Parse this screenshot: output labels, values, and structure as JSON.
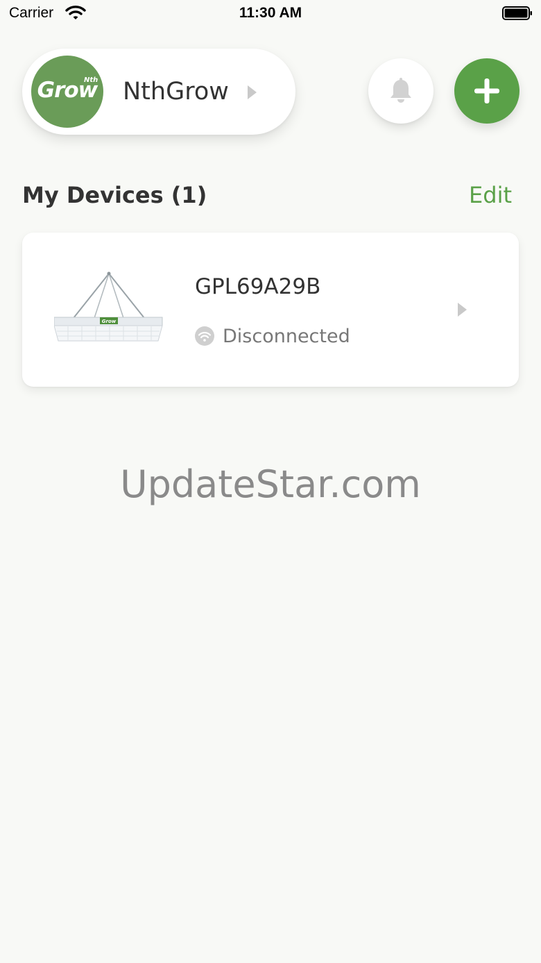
{
  "status_bar": {
    "carrier": "Carrier",
    "time": "11:30 AM"
  },
  "header": {
    "brand_logo_text": "Grow",
    "brand_logo_superscript": "Nth",
    "brand_name": "NthGrow"
  },
  "devices_section": {
    "title": "My Devices (1)",
    "edit_label": "Edit"
  },
  "devices": [
    {
      "image_badge": "Grow",
      "name": "GPL69A29B",
      "status": "Disconnected"
    }
  ],
  "watermark": "UpdateStar.com",
  "colors": {
    "background": "#f8f9f6",
    "accent_green": "#5aa148",
    "logo_green": "#6a9c58",
    "text_primary": "#333333",
    "text_secondary": "#777777",
    "icon_grey": "#cfcfcf"
  },
  "icons": {
    "status_wifi": "wifi-icon",
    "status_battery": "battery-icon",
    "brand_chevron": "chevron-right-icon",
    "notifications": "bell-icon",
    "add": "plus-icon",
    "device_connection": "wifi-off-icon",
    "device_chevron": "chevron-right-icon"
  }
}
